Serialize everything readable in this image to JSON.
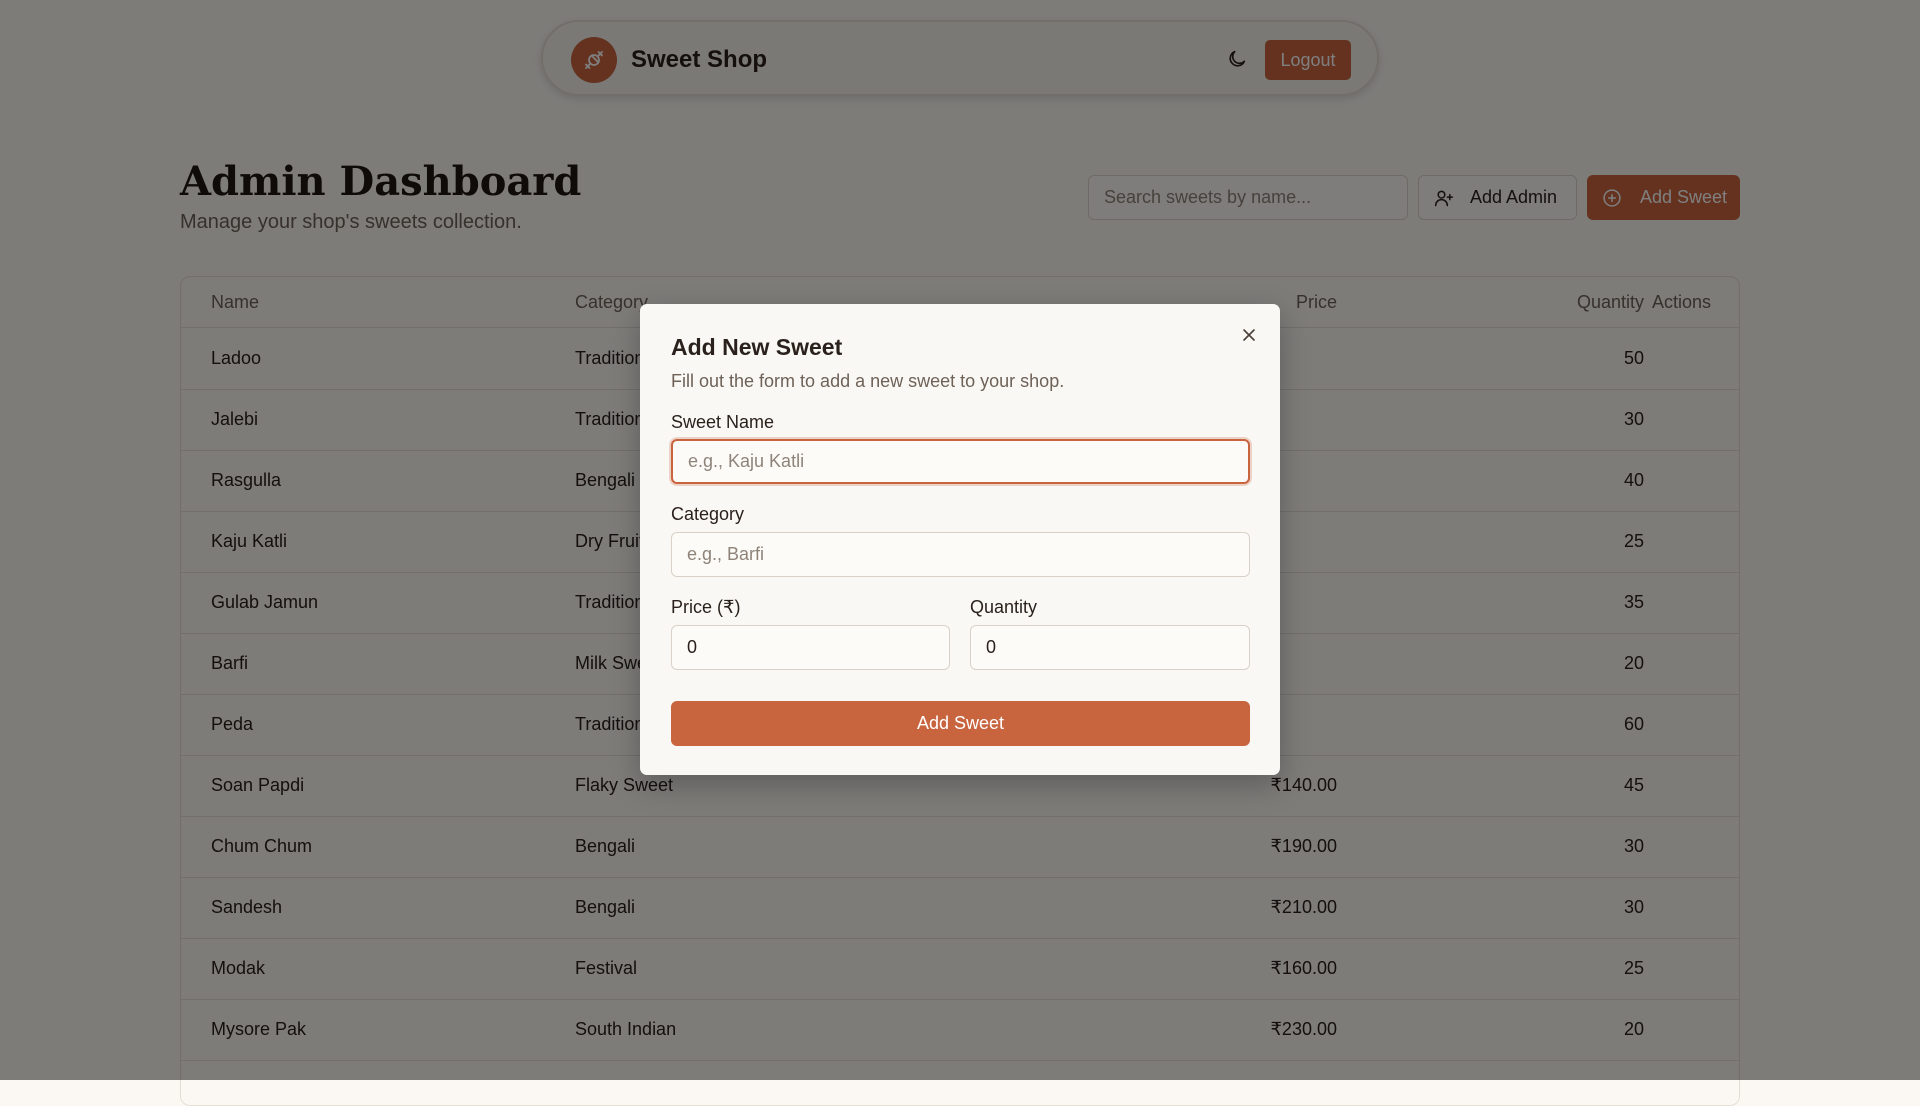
{
  "colors": {
    "accent": "#c8643e",
    "background": "#fbf8f3"
  },
  "navbar": {
    "brand": "Sweet Shop",
    "logo_icon": "candy-icon",
    "theme_icon": "moon-icon",
    "logout_label": "Logout"
  },
  "page": {
    "title": "Admin Dashboard",
    "subtitle": "Manage your shop's sweets collection."
  },
  "toolbar": {
    "search_placeholder": "Search sweets by name...",
    "add_admin_label": "Add Admin",
    "add_sweet_label": "Add Sweet"
  },
  "table": {
    "columns": [
      "Name",
      "Category",
      "Price",
      "Quantity",
      "Actions"
    ],
    "rows": [
      {
        "name": "Ladoo",
        "category": "Traditional",
        "price": "",
        "quantity": "50"
      },
      {
        "name": "Jalebi",
        "category": "Traditional",
        "price": "",
        "quantity": "30"
      },
      {
        "name": "Rasgulla",
        "category": "Bengali",
        "price": "",
        "quantity": "40"
      },
      {
        "name": "Kaju Katli",
        "category": "Dry Fruit",
        "price": "",
        "quantity": "25"
      },
      {
        "name": "Gulab Jamun",
        "category": "Traditional",
        "price": "",
        "quantity": "35"
      },
      {
        "name": "Barfi",
        "category": "Milk Sweet",
        "price": "",
        "quantity": "20"
      },
      {
        "name": "Peda",
        "category": "Traditional",
        "price": "",
        "quantity": "60"
      },
      {
        "name": "Soan Papdi",
        "category": "Flaky Sweet",
        "price": "₹140.00",
        "quantity": "45"
      },
      {
        "name": "Chum Chum",
        "category": "Bengali",
        "price": "₹190.00",
        "quantity": "30"
      },
      {
        "name": "Sandesh",
        "category": "Bengali",
        "price": "₹210.00",
        "quantity": "30"
      },
      {
        "name": "Modak",
        "category": "Festival",
        "price": "₹160.00",
        "quantity": "25"
      },
      {
        "name": "Mysore Pak",
        "category": "South Indian",
        "price": "₹230.00",
        "quantity": "20"
      }
    ],
    "row_action_label": "···"
  },
  "modal": {
    "title": "Add New Sweet",
    "description": "Fill out the form to add a new sweet to your shop.",
    "close_icon": "close-icon",
    "name_label": "Sweet Name",
    "name_placeholder": "e.g., Kaju Katli",
    "category_label": "Category",
    "category_placeholder": "e.g., Barfi",
    "price_label": "Price (₹)",
    "price_value": "0",
    "quantity_label": "Quantity",
    "quantity_value": "0",
    "submit_label": "Add Sweet"
  }
}
